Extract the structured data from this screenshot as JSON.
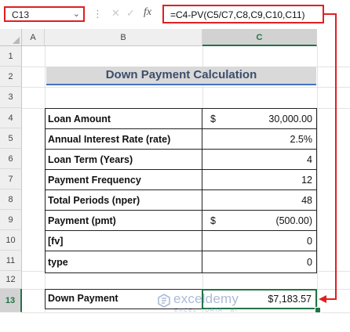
{
  "formula_bar": {
    "name_box": "C13",
    "cancel_icon": "✕",
    "enter_icon": "✓",
    "fx_label": "fx",
    "formula": "=C4-PV(C5/C7,C8,C9,C10,C11)"
  },
  "columns": [
    "A",
    "B",
    "C"
  ],
  "rows": [
    "1",
    "2",
    "3",
    "4",
    "5",
    "6",
    "7",
    "8",
    "9",
    "10",
    "11",
    "12",
    "13"
  ],
  "selected_cell": {
    "column": "C",
    "row": "13"
  },
  "title": "Down Payment Calculation",
  "table": [
    {
      "label": "Loan Amount",
      "currency": "$",
      "value": "30,000.00"
    },
    {
      "label": "Annual Interest Rate (rate)",
      "currency": "",
      "value": "2.5%"
    },
    {
      "label": "Loan Term (Years)",
      "currency": "",
      "value": "4"
    },
    {
      "label": "Payment Frequency",
      "currency": "",
      "value": "12"
    },
    {
      "label": "Total Periods (nper)",
      "currency": "",
      "value": "48"
    },
    {
      "label": "Payment (pmt)",
      "currency": "$",
      "value": "(500.00)"
    },
    {
      "label": "[fv]",
      "currency": "",
      "value": "0"
    },
    {
      "label": "type",
      "currency": "",
      "value": "0"
    }
  ],
  "result": {
    "label": "Down Payment",
    "value": "$7,183.57"
  },
  "watermark": {
    "name": "exceldemy",
    "tagline": "EXCEL · DATA · BI"
  },
  "colors": {
    "highlight_red": "#e02020",
    "excel_green": "#217346",
    "title_underline": "#4472c4",
    "title_fill": "#d9d9d9"
  }
}
